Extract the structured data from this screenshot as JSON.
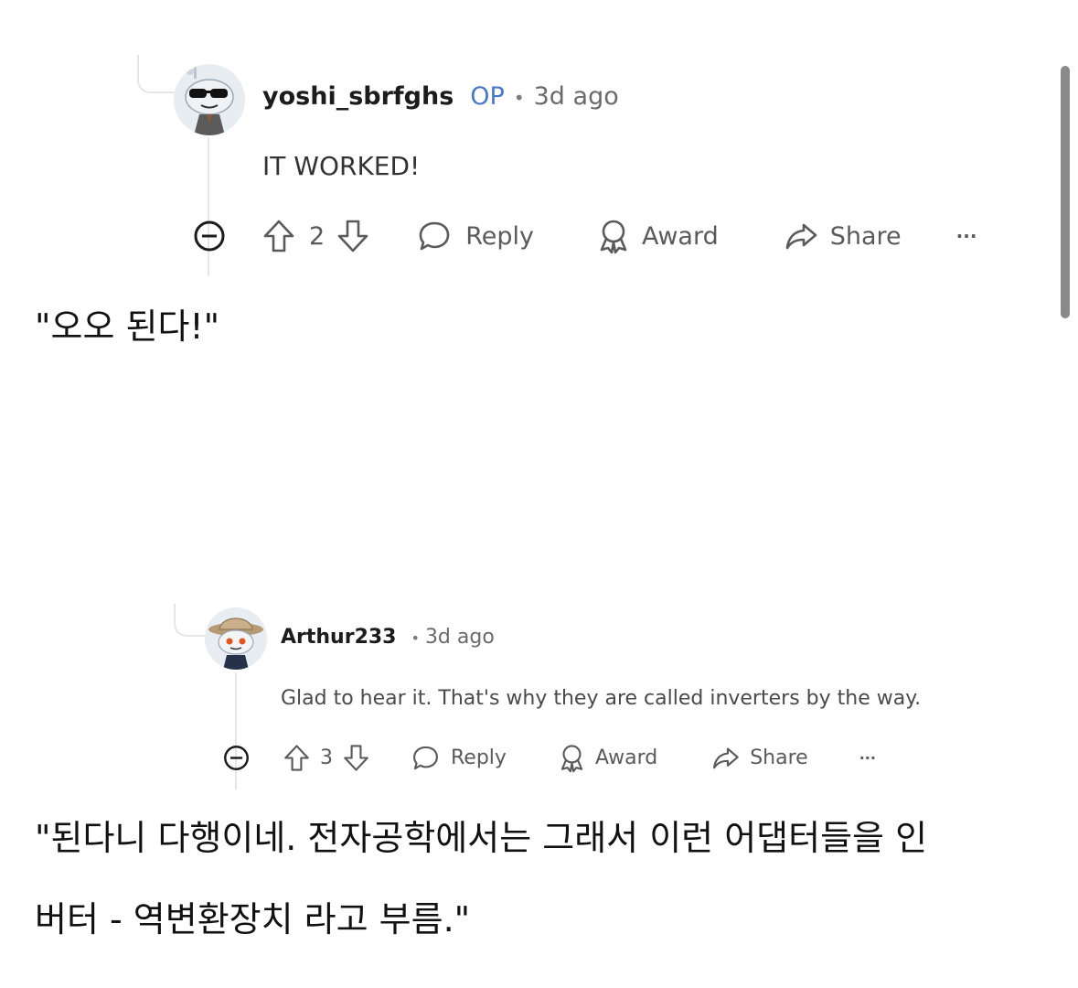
{
  "comments": [
    {
      "username": "yoshi_sbrfghs",
      "op_badge": "OP",
      "separator": "•",
      "time": "3d ago",
      "body": "IT WORKED!",
      "votes": "2",
      "reply_label": "Reply",
      "award_label": "Award",
      "share_label": "Share",
      "more_label": "···"
    },
    {
      "username": "Arthur233",
      "separator": "•",
      "time": "3d ago",
      "body": "Glad to hear it. That's why they are called inverters by the way.",
      "votes": "3",
      "reply_label": "Reply",
      "award_label": "Award",
      "share_label": "Share",
      "more_label": "···"
    }
  ],
  "captions": {
    "first": "\"오오 된다!\"",
    "second_line1": "\"된다니 다행이네. 전자공학에서는 그래서 이런 어댑터들을 인",
    "second_line2": "버터 - 역변환장치 라고 부름.\""
  },
  "colors": {
    "op_badge": "#4a78c8",
    "thread_line": "#e6e6e6",
    "action_text": "#5a5a5a"
  }
}
